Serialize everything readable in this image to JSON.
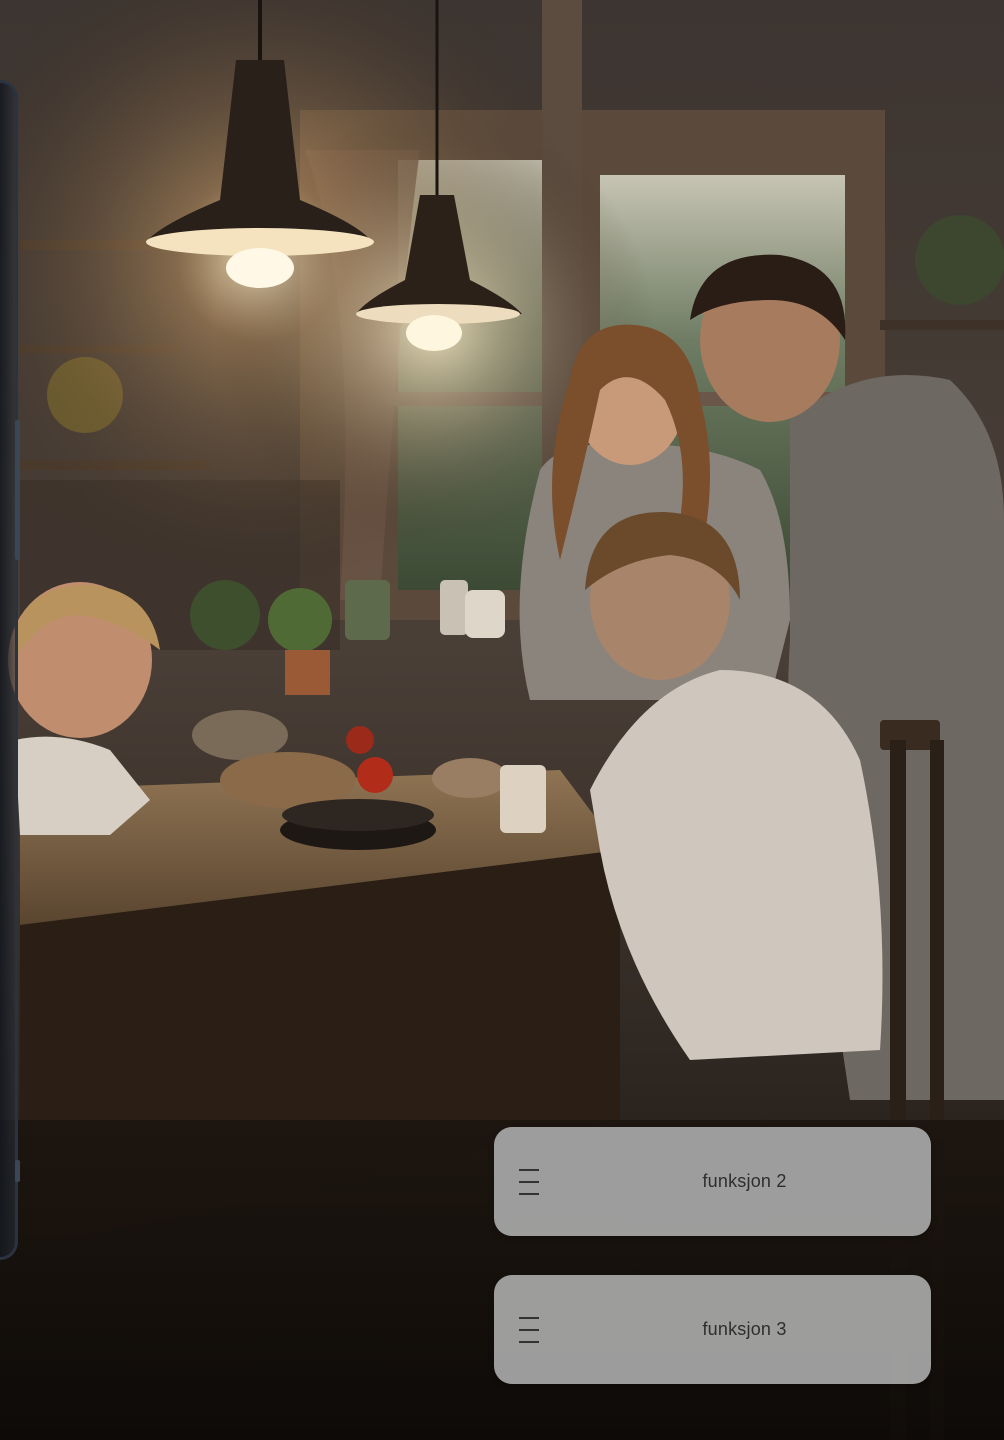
{
  "buttons": [
    {
      "label": "funksjon 2",
      "icon": "menu-icon"
    },
    {
      "label": "funksjon 3",
      "icon": "menu-icon"
    }
  ],
  "colors": {
    "button_bg": "#a8a8a8",
    "button_text": "#2e2e2e",
    "device_frame": "#2a3340"
  }
}
